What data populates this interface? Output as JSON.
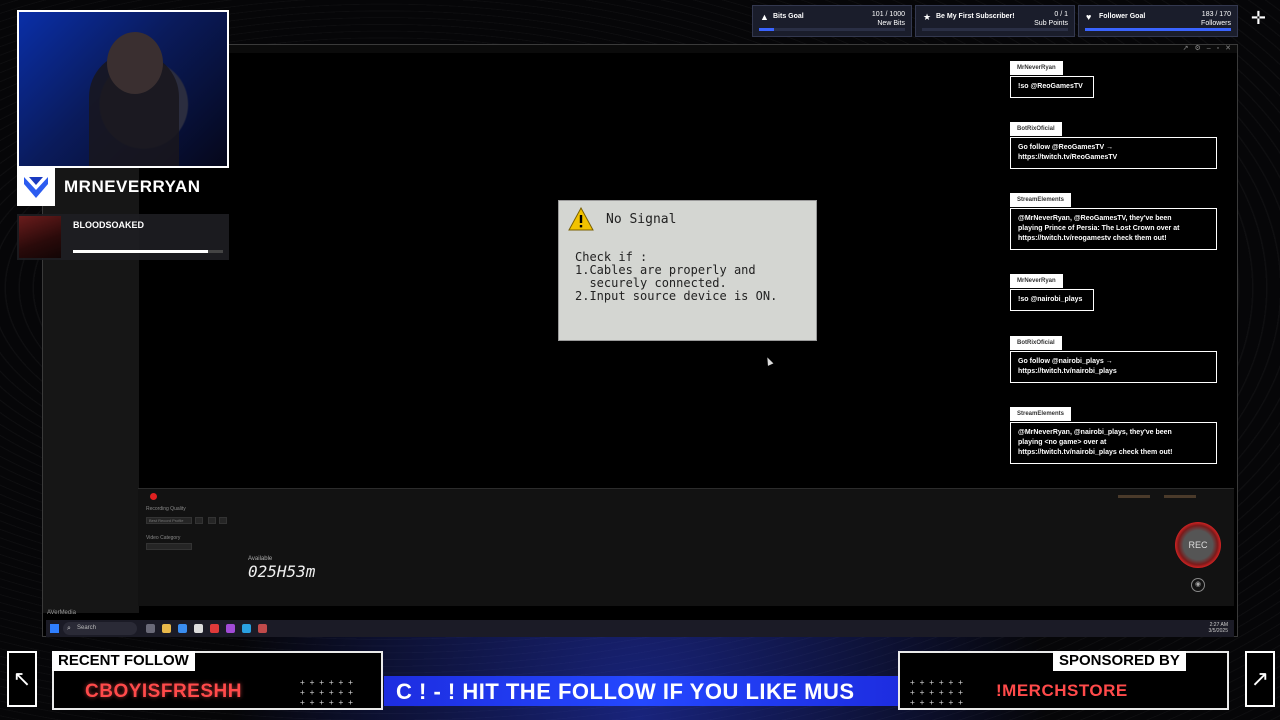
{
  "streamer": {
    "name": "MRNEVERRYAN"
  },
  "game": {
    "title": "BLOODSOAKED",
    "progress": 0.9
  },
  "goals": [
    {
      "name": "Bits Goal",
      "count": "101 / 1000",
      "unit": "New Bits",
      "progress": 0.1,
      "icon": "triangle-icon"
    },
    {
      "name": "Be My First Subscriber!",
      "count": "0 / 1",
      "unit": "Sub Points",
      "progress": 0.0,
      "icon": "star-icon"
    },
    {
      "name": "Follower Goal",
      "count": "183 / 170",
      "unit": "Followers",
      "progress": 1.0,
      "icon": "heart-icon"
    }
  ],
  "dialog": {
    "title": "No Signal",
    "body": "Check if :\n1.Cables are properly and\n  securely connected.\n2.Input source device is ON."
  },
  "chat": [
    {
      "user": "MrNeverRyan",
      "text": "!so @ReoGamesTV"
    },
    {
      "user": "BotRixOficial",
      "text": "Go follow @ReoGamesTV →\nhttps://twitch.tv/ReoGamesTV"
    },
    {
      "user": "StreamElements",
      "text": "@MrNeverRyan, @ReoGamesTV, they've been\nplaying Prince of Persia: The Lost Crown over at\nhttps://twitch.tv/reogamestv check them out!"
    },
    {
      "user": "MrNeverRyan",
      "text": "!so @nairobi_plays"
    },
    {
      "user": "BotRixOficial",
      "text": "Go follow @nairobi_plays →\nhttps://twitch.tv/nairobi_plays"
    },
    {
      "user": "StreamElements",
      "text": "@MrNeverRyan, @nairobi_plays, they've been\nplaying <no game> over at\nhttps://twitch.tv/nairobi_plays check them out!"
    }
  ],
  "recorder": {
    "quality_label": "Recording Quality",
    "quality_value": "Best Record Profile",
    "category_label": "Video Category",
    "category_value": "",
    "available_label": "Available",
    "available_time": "025H53m",
    "rec_label": "REC",
    "brand": "AVerMedia"
  },
  "taskbar": {
    "search_placeholder": "Search",
    "time": "2:27 AM",
    "date": "3/5/2025"
  },
  "bottom": {
    "recent_follow_label": "RECENT FOLLOW",
    "recent_follower": "CBOYISFRESHH",
    "ticker": "C ! - ! HIT THE FOLLOW IF YOU LIKE MUS",
    "sponsored_label": "SPONSORED BY",
    "sponsor": "!MERCHSTORE"
  }
}
